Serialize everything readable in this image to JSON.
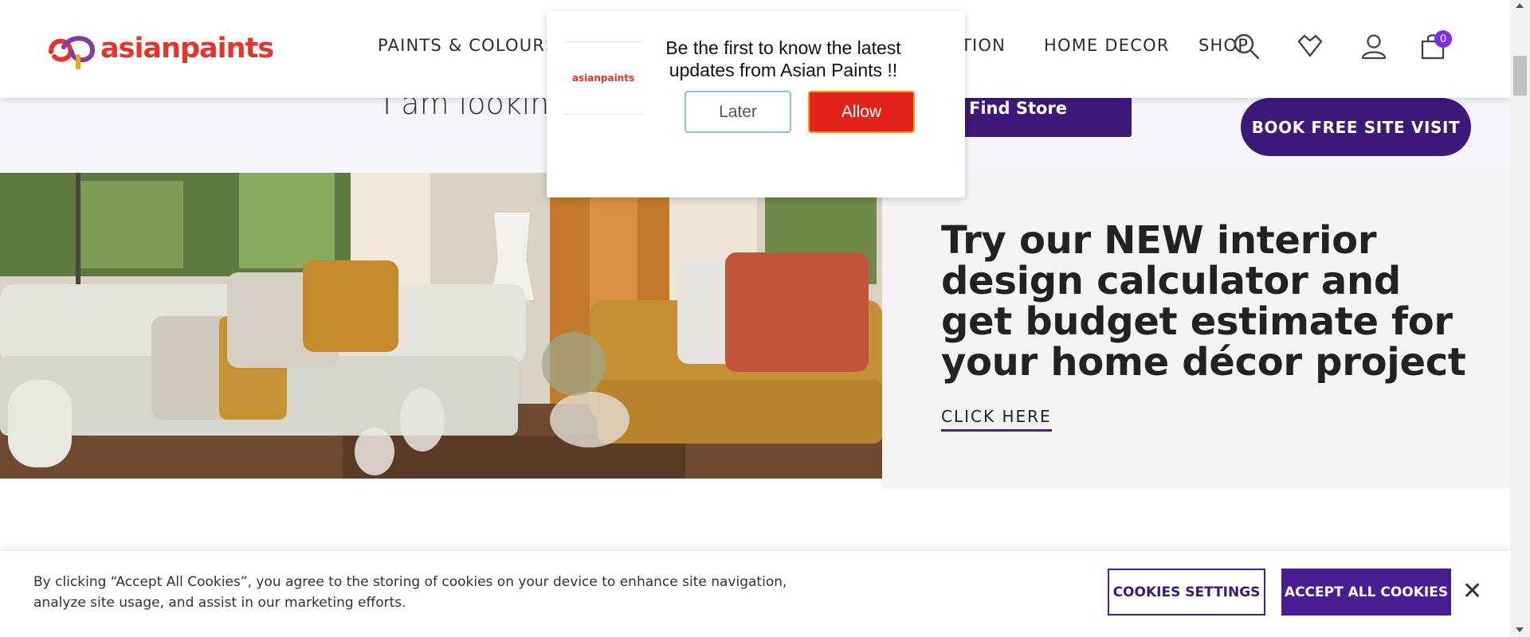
{
  "header": {
    "logo_text": "asianpaints",
    "nav": [
      "PAINTS & COLOURS",
      "TION",
      "HOME DECOR",
      "SHOP"
    ],
    "icons": [
      "search-icon",
      "wishlist-icon",
      "user-icon",
      "cart-icon"
    ],
    "cart_count": "0"
  },
  "search_strip": {
    "looking_text": "I am looking",
    "find_store_label": "Find Store",
    "book_visit_label": "BOOK FREE SITE VISIT"
  },
  "promo": {
    "title": "Try our NEW interior design calculator and get budget estimate for your home décor project",
    "cta": "CLICK HERE"
  },
  "notification_popup": {
    "logo_text": "asianpaints",
    "message": "Be the first to know the latest updates from Asian Paints !!",
    "later_label": "Later",
    "allow_label": "Allow"
  },
  "cookie_banner": {
    "text": "By clicking “Accept All Cookies”, you agree to the storing of cookies on your device to enhance site navigation, analyze site usage, and assist in our marketing efforts.",
    "settings_label": "COOKIES SETTINGS",
    "accept_label": "ACCEPT ALL COOKIES",
    "close_symbol": "✕"
  },
  "colors": {
    "brand_red": "#e8332b",
    "brand_purple": "#3d1a7a",
    "allow_red": "#e2231a"
  }
}
